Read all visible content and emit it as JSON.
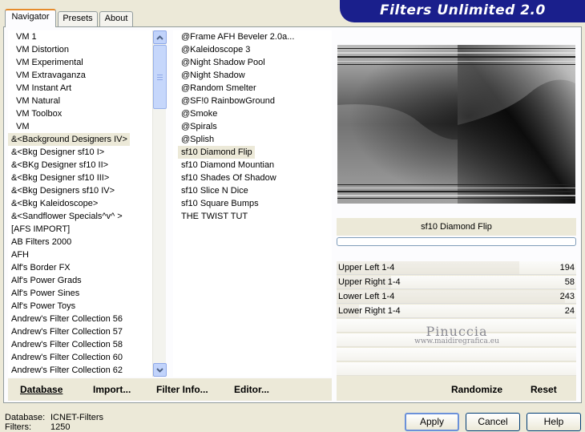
{
  "banner": {
    "title": "Filters Unlimited 2.0"
  },
  "tabs": [
    {
      "label": "Navigator"
    },
    {
      "label": "Presets"
    },
    {
      "label": "About"
    }
  ],
  "categories": [
    "VM 1",
    "VM Distortion",
    "VM Experimental",
    "VM Extravaganza",
    "VM Instant Art",
    "VM Natural",
    "VM Toolbox",
    "VM",
    "&<Background Designers IV>",
    "&<Bkg Designer sf10 I>",
    "&<BKg Designer sf10 II>",
    "&<Bkg Designer sf10 III>",
    "&<Bkg Designers sf10 IV>",
    "&<Bkg Kaleidoscope>",
    "&<Sandflower Specials^v^ >",
    "[AFS IMPORT]",
    "AB Filters 2000",
    "AFH",
    "Alf's Border FX",
    "Alf's Power Grads",
    "Alf's Power Sines",
    "Alf's Power Toys",
    "Andrew's Filter Collection 56",
    "Andrew's Filter Collection 57",
    "Andrew's Filter Collection 58",
    "Andrew's Filter Collection 60",
    "Andrew's Filter Collection 62"
  ],
  "selected_category_index": 8,
  "filters": [
    "@Frame AFH Beveler 2.0a...",
    "@Kaleidoscope 3",
    "@Night Shadow Pool",
    "@Night Shadow",
    "@Random Smelter",
    "@SF!0 RainbowGround",
    "@Smoke",
    "@Spirals",
    "@Splish",
    "sf10 Diamond Flip",
    "sf10 Diamond Mountian",
    "sf10 Shades Of Shadow",
    "sf10 Slice N Dice",
    "sf10 Square Bumps",
    "THE TWIST TUT"
  ],
  "selected_filter_index": 9,
  "current_filter": "sf10 Diamond Flip",
  "progress": 0,
  "sliders": [
    {
      "label": "Upper Left 1-4",
      "value": "194",
      "fraction": 0.761
    },
    {
      "label": "Upper Right 1-4",
      "value": "58",
      "fraction": 0.227
    },
    {
      "label": "Lower Left 1-4",
      "value": "243",
      "fraction": 0.953
    },
    {
      "label": "Lower Right 1-4",
      "value": "24",
      "fraction": 0.094
    }
  ],
  "watermark": {
    "name": "Pinuccia",
    "url": "www.maidiregrafica.eu"
  },
  "bottom_links": {
    "database": "Database",
    "import": "Import...",
    "filter_info": "Filter Info...",
    "editor": "Editor...",
    "randomize": "Randomize",
    "reset": "Reset"
  },
  "status": {
    "database_label": "Database:",
    "database_value": "ICNET-Filters",
    "filters_label": "Filters:",
    "filters_value": "1250"
  },
  "buttons": {
    "apply": "Apply",
    "cancel": "Cancel",
    "help": "Help"
  }
}
